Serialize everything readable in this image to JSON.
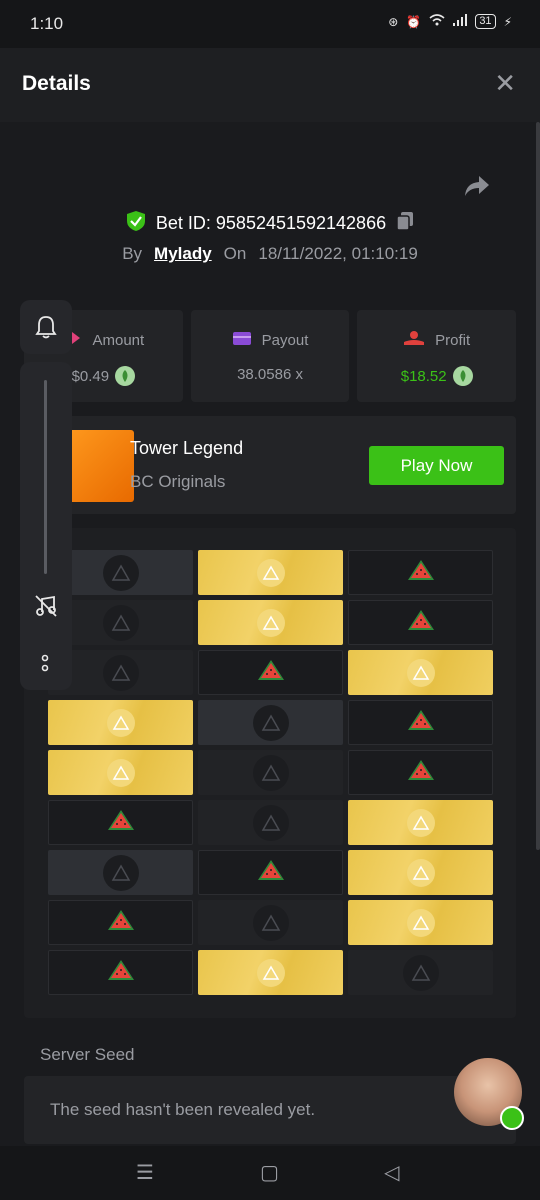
{
  "status_bar": {
    "time": "1:10",
    "battery": "31"
  },
  "header": {
    "title": "Details",
    "close_icon": "close-icon"
  },
  "bet": {
    "id_label": "Bet ID: 95852451592142866",
    "by_label": "By",
    "user": "Mylady",
    "on_label": "On",
    "datetime": "18/11/2022, 01:10:19"
  },
  "stats": {
    "amount": {
      "label": "Amount",
      "value": "$0.49"
    },
    "payout": {
      "label": "Payout",
      "value": "38.0586 x"
    },
    "profit": {
      "label": "Profit",
      "value": "$18.52"
    }
  },
  "game": {
    "name": "Tower Legend",
    "provider": "BC Originals",
    "play_label": "Play Now"
  },
  "grid": {
    "rows": [
      [
        "grey",
        "gold",
        "melon"
      ],
      [
        "shade",
        "gold",
        "melon"
      ],
      [
        "shade",
        "melon",
        "gold"
      ],
      [
        "gold",
        "grey",
        "melon"
      ],
      [
        "gold",
        "shade",
        "melon"
      ],
      [
        "melon",
        "shade",
        "gold"
      ],
      [
        "grey",
        "melon",
        "gold"
      ],
      [
        "melon",
        "shade",
        "gold"
      ],
      [
        "melon",
        "gold",
        "shade"
      ]
    ]
  },
  "server_seed": {
    "label": "Server Seed",
    "text": "The seed hasn't been revealed yet."
  },
  "colors": {
    "accent": "#3bc117",
    "gold": "#f0cf60",
    "bg": "#1a1b1e"
  }
}
